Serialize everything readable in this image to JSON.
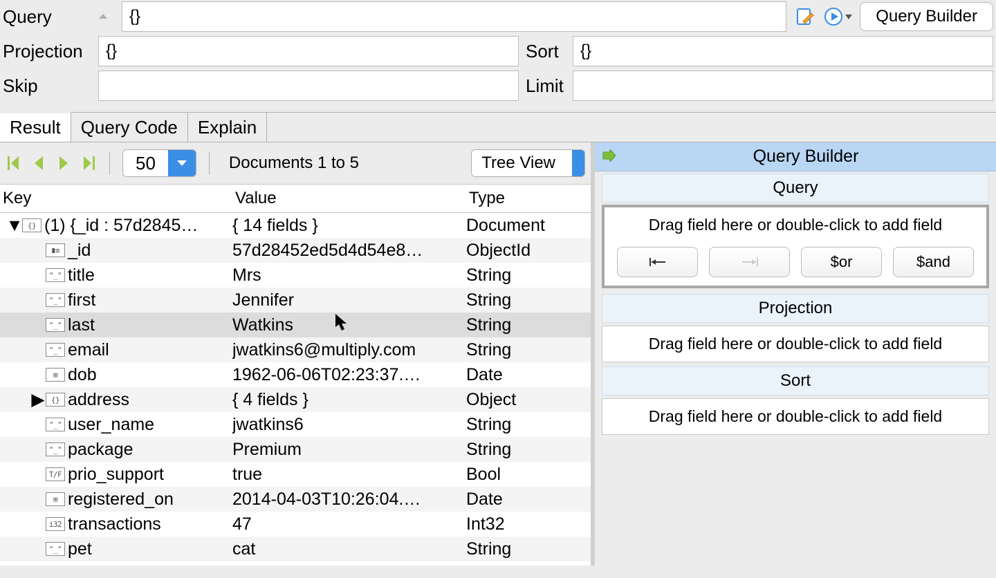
{
  "form": {
    "query_label": "Query",
    "query_value": "{}",
    "projection_label": "Projection",
    "projection_value": "{}",
    "sort_label": "Sort",
    "sort_value": "{}",
    "skip_label": "Skip",
    "skip_value": "",
    "limit_label": "Limit",
    "limit_value": "",
    "query_builder_button": "Query Builder"
  },
  "tabs": {
    "result": "Result",
    "query_code": "Query Code",
    "explain": "Explain"
  },
  "toolbar": {
    "page_size": "50",
    "doc_range": "Documents 1 to 5",
    "view_mode": "Tree View"
  },
  "tree": {
    "headers": {
      "key": "Key",
      "value": "Value",
      "type": "Type"
    },
    "root": {
      "label": "(1) {_id : 57d2845…",
      "value": "{ 14 fields }",
      "type": "Document"
    },
    "rows": [
      {
        "key": "_id",
        "value": "57d28452ed5d4d54e8…",
        "type": "ObjectId",
        "icon": "id"
      },
      {
        "key": "title",
        "value": "Mrs",
        "type": "String",
        "icon": "str"
      },
      {
        "key": "first",
        "value": "Jennifer",
        "type": "String",
        "icon": "str"
      },
      {
        "key": "last",
        "value": "Watkins",
        "type": "String",
        "icon": "str",
        "cursor": true
      },
      {
        "key": "email",
        "value": "jwatkins6@multiply.com",
        "type": "String",
        "icon": "str"
      },
      {
        "key": "dob",
        "value": "1962-06-06T02:23:37.…",
        "type": "Date",
        "icon": "date"
      },
      {
        "key": "address",
        "value": "{ 4 fields }",
        "type": "Object",
        "icon": "obj",
        "expandable": true
      },
      {
        "key": "user_name",
        "value": "jwatkins6",
        "type": "String",
        "icon": "str"
      },
      {
        "key": "package",
        "value": "Premium",
        "type": "String",
        "icon": "str"
      },
      {
        "key": "prio_support",
        "value": "true",
        "type": "Bool",
        "icon": "bool"
      },
      {
        "key": "registered_on",
        "value": "2014-04-03T10:26:04.…",
        "type": "Date",
        "icon": "date"
      },
      {
        "key": "transactions",
        "value": "47",
        "type": "Int32",
        "icon": "int"
      },
      {
        "key": "pet",
        "value": "cat",
        "type": "String",
        "icon": "str"
      }
    ]
  },
  "builder": {
    "panel_title": "Query Builder",
    "query_title": "Query",
    "projection_title": "Projection",
    "sort_title": "Sort",
    "drop_hint": "Drag field here or double-click to add field",
    "btn_or": "$or",
    "btn_and": "$and"
  }
}
